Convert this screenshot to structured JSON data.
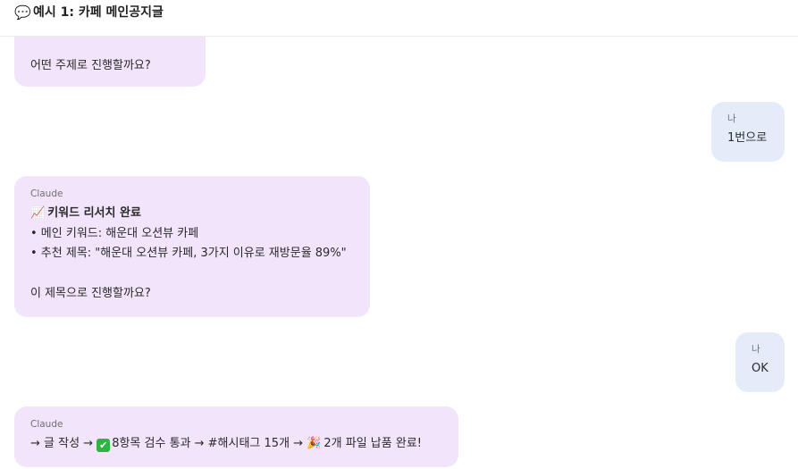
{
  "header": {
    "icon": "speech-bubble-icon",
    "icon_glyph": "💬",
    "title": "예시 1: 카페 메인공지글"
  },
  "messages": [
    {
      "role": "claude",
      "sender": "",
      "lines": [
        "어떤 주제로 진행할까요?"
      ]
    },
    {
      "role": "user",
      "sender": "나",
      "text": "1번으로"
    },
    {
      "role": "claude",
      "sender": "Claude",
      "heading_icon": "📈",
      "heading": "키워드 리서치 완료",
      "lines": [
        "• 메인 키워드: 해운대 오션뷰 카페",
        "• 추천 제목: \"해운대 오션뷰 카페, 3가지 이유로 재방문율 89%\"",
        "",
        "이 제목으로 진행할까요?"
      ]
    },
    {
      "role": "user",
      "sender": "나",
      "text": "OK"
    },
    {
      "role": "claude",
      "sender": "Claude",
      "flow": {
        "part1": "→ 글 작성 →",
        "check_glyph": "✔",
        "part2": "8항목 검수 통과 → #해시태그 15개 →",
        "party_glyph": "🎉",
        "part3": "2개 파일 납품 완료!"
      }
    }
  ]
}
